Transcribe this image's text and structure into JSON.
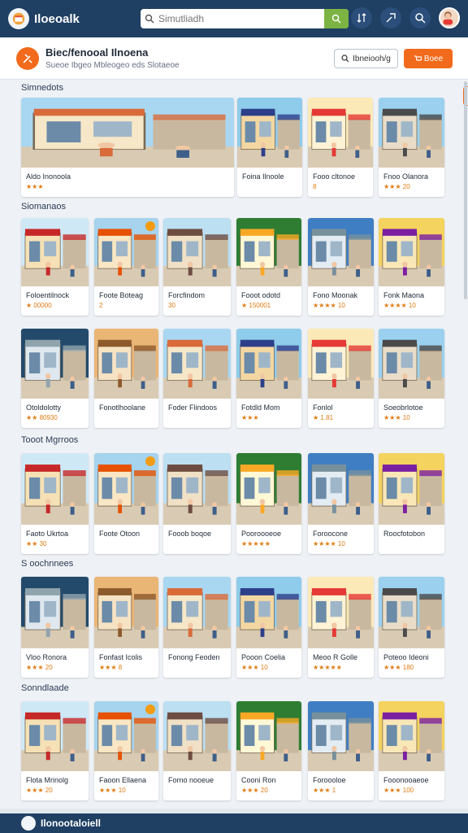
{
  "app": {
    "title": "Iloeoalk",
    "search_placeholder": "Simutliadh"
  },
  "subheader": {
    "title": "Biec/fenooal Ilnoena",
    "description": "Sueoe Ibgeo  Mbleogeo eds Slotaeoe",
    "filter_label": "Ibneiooh/g",
    "action_label": "Boee"
  },
  "sections": [
    {
      "label": "Simnedots",
      "cards": [
        {
          "title": "Aldo Inonoola",
          "rating": "★★★"
        },
        {
          "title": "Foina Ilnoole",
          "rating": ""
        },
        {
          "title": "Fooo cltonoe",
          "rating": "8"
        },
        {
          "title": "Fnoo Olanora",
          "rating": "★★★ 20"
        }
      ]
    },
    {
      "label": "Siomanaos",
      "cards": [
        {
          "title": "Foloentilnock",
          "rating": "★ 00000"
        },
        {
          "title": "Foote Boteag",
          "rating": "2"
        },
        {
          "title": "Forcfindom",
          "rating": "30"
        },
        {
          "title": "Fooot odotd",
          "rating": "★ 150001"
        },
        {
          "title": "Fono Moonak",
          "rating": "★★★★ 10"
        },
        {
          "title": "Fonk Maona",
          "rating": "★★★★ 10"
        },
        {
          "title": "Otoldolotty",
          "rating": "★★ 80930"
        },
        {
          "title": "Fonotlhoolane",
          "rating": ""
        },
        {
          "title": "Foder Flindoos",
          "rating": ""
        },
        {
          "title": "Fotdld Mom",
          "rating": "★★★"
        },
        {
          "title": "Fonlol",
          "rating": "★ 1.81"
        },
        {
          "title": "Soeobrlotoe",
          "rating": "★★★ 10"
        }
      ]
    },
    {
      "label": "Tooot Mgrroos",
      "cards": [
        {
          "title": "Faoto Ukrtoa",
          "rating": "★★ 30"
        },
        {
          "title": "Foote Otoon",
          "rating": ""
        },
        {
          "title": "Fooob boqoe",
          "rating": ""
        },
        {
          "title": "Pooroooeoe",
          "rating": "★★★★★"
        },
        {
          "title": "Foroocone",
          "rating": "★★★★ 10"
        },
        {
          "title": "Roocfotobon",
          "rating": ""
        }
      ]
    },
    {
      "label": "S oochnnees",
      "cards": [
        {
          "title": "Vloo Ronora",
          "rating": "★★★ 20"
        },
        {
          "title": "Fonfast Icolis",
          "rating": "★★★ 8"
        },
        {
          "title": "Fonong Feoden",
          "rating": ""
        },
        {
          "title": "Pooon Coelia",
          "rating": "★★★ 10"
        },
        {
          "title": "Meoo R Golle",
          "rating": "★★★★★"
        },
        {
          "title": "Poteoo Ideoni",
          "rating": "★★★ 180"
        }
      ]
    },
    {
      "label": "Sonndlaade",
      "cards": [
        {
          "title": "Flota Mrinolg",
          "rating": "★★★ 20"
        },
        {
          "title": "Faoon Ellaena",
          "rating": "★★★ 10"
        },
        {
          "title": "Forno nooeue",
          "rating": ""
        },
        {
          "title": "Cooni Ron",
          "rating": "★★★ 20"
        },
        {
          "title": "Foroooloe",
          "rating": "★★★ 1"
        },
        {
          "title": "Fooonooaeoe",
          "rating": "★★★ 100"
        }
      ]
    }
  ],
  "footer": {
    "label": "Ilonootaloiell"
  },
  "colors": {
    "nav": "#1f3f63",
    "accent": "#f26a1b",
    "search_go": "#7cb342",
    "background": "#eef1f5"
  },
  "icons": [
    "logo-icon",
    "search-icon",
    "sort-icon",
    "share-icon",
    "magnifier-icon",
    "user-avatar",
    "fork-knife-icon",
    "filter-icon",
    "cart-icon"
  ]
}
